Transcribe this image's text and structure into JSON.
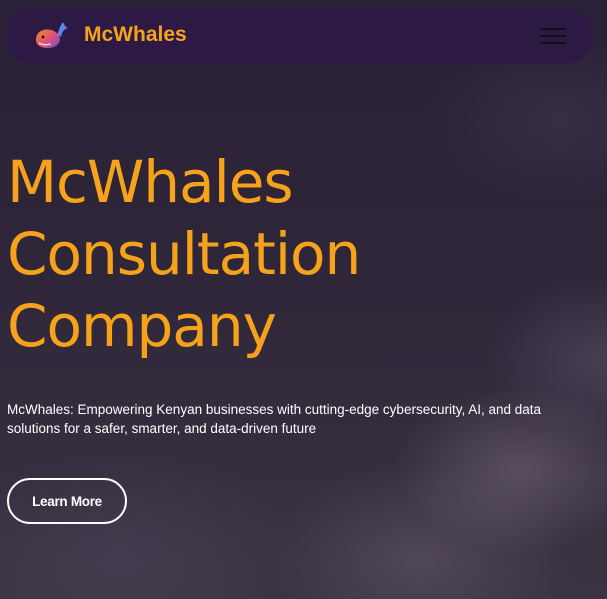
{
  "navbar": {
    "brand": "McWhales",
    "logo_icon": "whale-logo-icon",
    "menu_icon": "hamburger-menu-icon"
  },
  "hero": {
    "title_lines": [
      "McWhales",
      "Consultation",
      "Company"
    ],
    "description": "McWhales: Empowering Kenyan businesses with cutting-edge cybersecurity, AI, and data solutions for a safer, smarter, and data-driven future",
    "cta_label": "Learn More"
  },
  "colors": {
    "accent": "#f7a21b",
    "navbar_bg": "#2c1a44",
    "background": "#2f2639",
    "text": "#ffffff"
  }
}
